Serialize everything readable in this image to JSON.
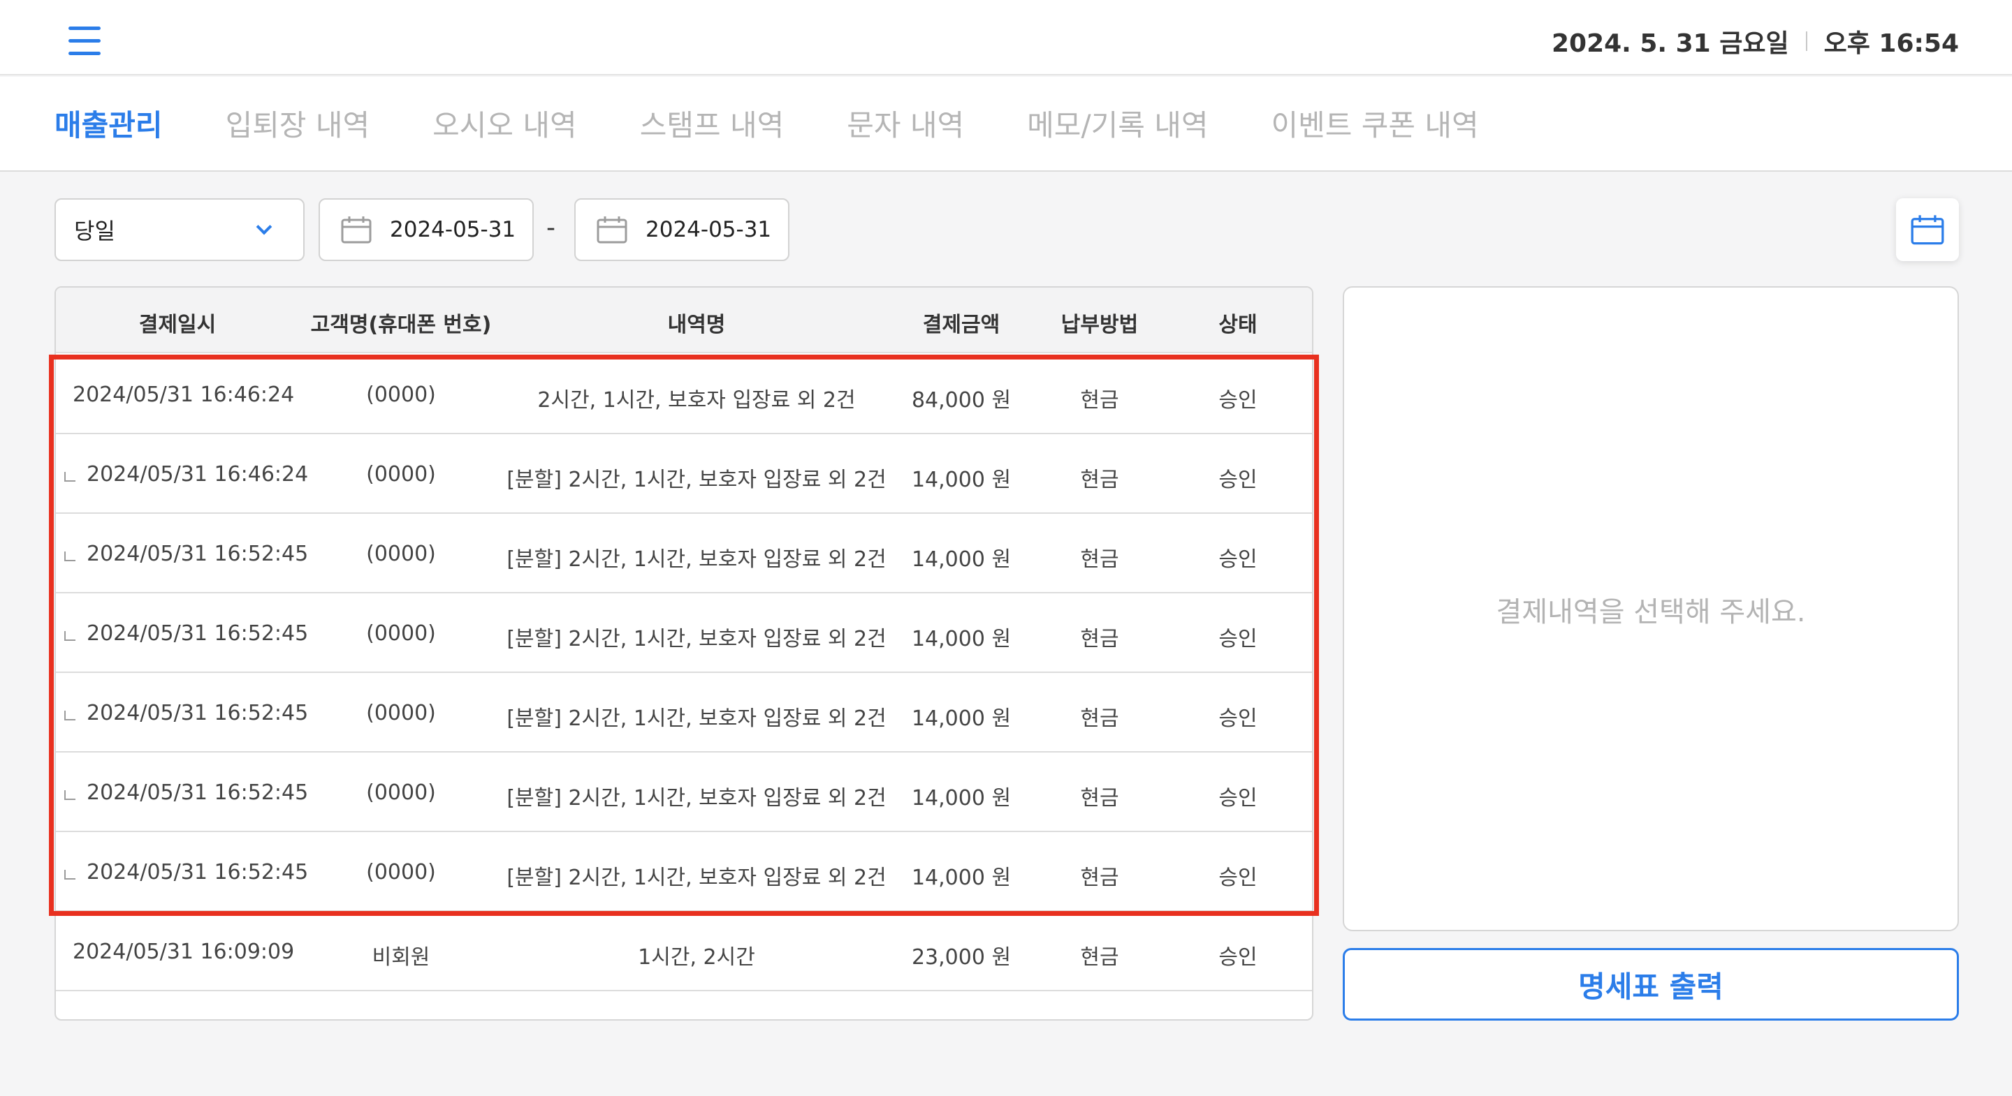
{
  "header": {
    "date": "2024. 5. 31 금요일",
    "time": "오후 16:54"
  },
  "tabs": [
    {
      "label": "매출관리",
      "active": true
    },
    {
      "label": "입퇴장 내역",
      "active": false
    },
    {
      "label": "오시오 내역",
      "active": false
    },
    {
      "label": "스탬프 내역",
      "active": false
    },
    {
      "label": "문자 내역",
      "active": false
    },
    {
      "label": "메모/기록 내역",
      "active": false
    },
    {
      "label": "이벤트 쿠폰 내역",
      "active": false
    }
  ],
  "filter": {
    "period": "당일",
    "start_date": "2024-05-31",
    "end_date": "2024-05-31",
    "separator": "-"
  },
  "table": {
    "columns": [
      "결제일시",
      "고객명(휴대폰 번호)",
      "내역명",
      "결제금액",
      "납부방법",
      "상태"
    ],
    "rows": [
      {
        "sub": false,
        "datetime": "2024/05/31 16:46:24",
        "customer": "(0000)",
        "item": "2시간, 1시간, 보호자 입장료 외 2건",
        "amount": "84,000 원",
        "method": "현금",
        "status": "승인"
      },
      {
        "sub": true,
        "datetime": "2024/05/31 16:46:24",
        "customer": "(0000)",
        "item": "[분할] 2시간, 1시간, 보호자 입장료 외 2건",
        "amount": "14,000 원",
        "method": "현금",
        "status": "승인"
      },
      {
        "sub": true,
        "datetime": "2024/05/31 16:52:45",
        "customer": "(0000)",
        "item": "[분할] 2시간, 1시간, 보호자 입장료 외 2건",
        "amount": "14,000 원",
        "method": "현금",
        "status": "승인"
      },
      {
        "sub": true,
        "datetime": "2024/05/31 16:52:45",
        "customer": "(0000)",
        "item": "[분할] 2시간, 1시간, 보호자 입장료 외 2건",
        "amount": "14,000 원",
        "method": "현금",
        "status": "승인"
      },
      {
        "sub": true,
        "datetime": "2024/05/31 16:52:45",
        "customer": "(0000)",
        "item": "[분할] 2시간, 1시간, 보호자 입장료 외 2건",
        "amount": "14,000 원",
        "method": "현금",
        "status": "승인"
      },
      {
        "sub": true,
        "datetime": "2024/05/31 16:52:45",
        "customer": "(0000)",
        "item": "[분할] 2시간, 1시간, 보호자 입장료 외 2건",
        "amount": "14,000 원",
        "method": "현금",
        "status": "승인"
      },
      {
        "sub": true,
        "datetime": "2024/05/31 16:52:45",
        "customer": "(0000)",
        "item": "[분할] 2시간, 1시간, 보호자 입장료 외 2건",
        "amount": "14,000 원",
        "method": "현금",
        "status": "승인"
      },
      {
        "sub": false,
        "datetime": "2024/05/31 16:09:09",
        "customer": "비회원",
        "item": "1시간, 2시간",
        "amount": "23,000 원",
        "method": "현금",
        "status": "승인"
      }
    ]
  },
  "detail": {
    "empty_message": "결제내역을 선택해 주세요.",
    "print_label": "명세표 출력"
  },
  "colors": {
    "accent": "#2b7de9",
    "highlight": "#e8301f"
  }
}
